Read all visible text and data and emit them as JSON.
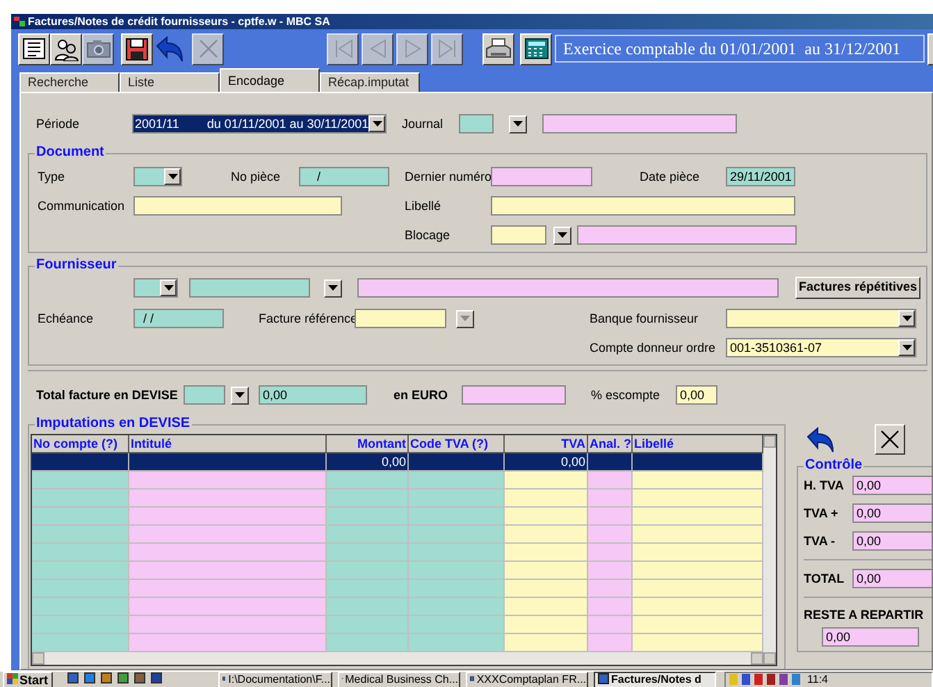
{
  "window": {
    "title": "Factures/Notes de crédit fournisseurs - cptfe.w - MBC SA"
  },
  "toolbar": {
    "exercice": "Exercice comptable du 01/01/2001  au 31/12/2001"
  },
  "tabs": [
    {
      "label": "Recherche",
      "selected": false
    },
    {
      "label": "Liste",
      "selected": false
    },
    {
      "label": "Encodage",
      "selected": true
    },
    {
      "label": "Récap.imputat",
      "selected": false
    }
  ],
  "periode": {
    "label": "Période",
    "value": "2001/11",
    "detail": "du 01/11/2001 au 30/11/2001",
    "journal_label": "Journal"
  },
  "document": {
    "title": "Document",
    "type_label": "Type",
    "no_piece_label": "No pièce",
    "no_piece": "/",
    "dernier_numero_label": "Dernier numéro",
    "date_piece_label": "Date pièce",
    "date_piece": "29/11/2001",
    "communication_label": "Communication",
    "libelle_label": "Libellé",
    "blocage_label": "Blocage"
  },
  "fournisseur": {
    "title": "Fournisseur",
    "repetitive_button": "Factures répétitives",
    "echeance_label": "Echéance",
    "echeance": "/ /",
    "facture_reference_label": "Facture référence",
    "banque_label": "Banque fournisseur",
    "compte_label": "Compte donneur ordre",
    "compte": "001-3510361-07"
  },
  "totals": {
    "devise_label": "Total facture en DEVISE",
    "devise": "0,00",
    "euro_label": "en EURO",
    "escompte_label": "% escompte",
    "escompte": "0,00"
  },
  "imputations": {
    "title": "Imputations en DEVISE",
    "columns": [
      {
        "label": "No compte (?)",
        "kind": "text",
        "color": "#a0dccf"
      },
      {
        "label": "Intitulé",
        "kind": "text",
        "color": "#f5c8f5"
      },
      {
        "label": "Montant",
        "kind": "amount",
        "color": "#a0dccf"
      },
      {
        "label": "Code TVA (?)",
        "kind": "text",
        "color": "#a0dccf"
      },
      {
        "label": "TVA",
        "kind": "amount",
        "color": "#fdf8c0"
      },
      {
        "label": "Anal. ?",
        "kind": "text",
        "color": "#f5c8f5"
      },
      {
        "label": "Libellé",
        "kind": "text",
        "color": "#fdf8c0"
      }
    ],
    "rows": [
      {
        "cells": [
          "",
          "",
          "0,00",
          "",
          "0,00",
          "",
          ""
        ],
        "selected": true
      }
    ]
  },
  "controle": {
    "title": "Contrôle",
    "items": [
      {
        "label": "H. TVA",
        "value": "0,00"
      },
      {
        "label": "TVA +",
        "value": "0,00"
      },
      {
        "label": "TVA -",
        "value": "0,00"
      },
      {
        "label": "TOTAL",
        "value": "0,00"
      }
    ],
    "reste_label": "RESTE A REPARTIR",
    "reste": "0,00"
  },
  "taskbar": {
    "start": "Start",
    "tasks": [
      {
        "label": "I:\\Documentation\\F...",
        "selected": false
      },
      {
        "label": "Medical Business Ch...",
        "selected": false
      },
      {
        "label": "XXXComptaplan FR...",
        "selected": false
      },
      {
        "label": "Factures/Notes d",
        "selected": true
      }
    ],
    "clock": "11:4"
  }
}
